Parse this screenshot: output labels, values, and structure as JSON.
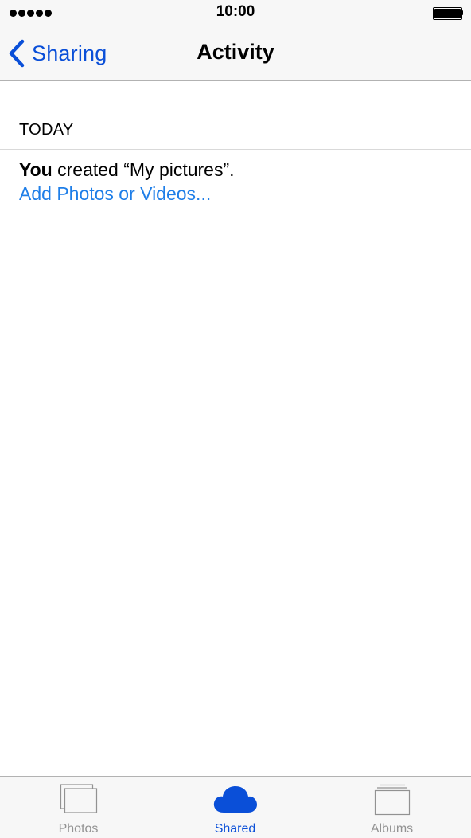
{
  "status_bar": {
    "time": "10:00",
    "signal_icon": "signal-dots-icon",
    "battery_icon": "battery-full-icon"
  },
  "nav": {
    "back_label": "Sharing",
    "back_icon": "chevron-left-icon",
    "title": "Activity"
  },
  "section": {
    "header": "TODAY"
  },
  "activity": {
    "actor": "You",
    "message": " created “My pictures”.",
    "link": "Add Photos or Videos..."
  },
  "tab_bar": {
    "tabs": [
      {
        "label": "Photos",
        "icon": "photos-stack-icon",
        "selected": false
      },
      {
        "label": "Shared",
        "icon": "cloud-icon",
        "selected": true
      },
      {
        "label": "Albums",
        "icon": "albums-stack-icon",
        "selected": false
      }
    ]
  },
  "colors": {
    "accent": "#0a4fd8",
    "link": "#1e7ee8",
    "inactive_tab": "#929292",
    "bar_background": "#f7f7f7"
  }
}
